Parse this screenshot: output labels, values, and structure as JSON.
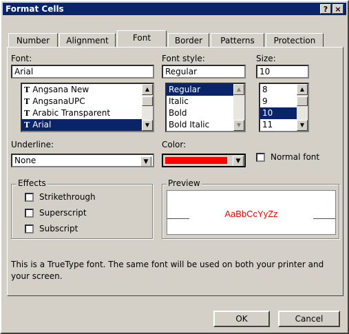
{
  "window": {
    "title": "Format Cells",
    "help_label": "?",
    "close_label": "×"
  },
  "tabs": [
    "Number",
    "Alignment",
    "Font",
    "Border",
    "Patterns",
    "Protection"
  ],
  "font": {
    "label": "Font:",
    "value": "Arial",
    "items": [
      "Angsana New",
      "AngsanaUPC",
      "Arabic Transparent",
      "Arial"
    ],
    "icon_glyph": "T"
  },
  "font_style": {
    "label": "Font style:",
    "value": "Regular",
    "items": [
      "Regular",
      "Italic",
      "Bold",
      "Bold Italic"
    ]
  },
  "size": {
    "label": "Size:",
    "value": "10",
    "items": [
      "8",
      "9",
      "10",
      "11"
    ]
  },
  "underline": {
    "label": "Underline:",
    "value": "None"
  },
  "color": {
    "label": "Color:",
    "swatch": "#ff0000"
  },
  "normal_font": {
    "label": "Normal font"
  },
  "effects": {
    "title": "Effects",
    "items": [
      "Strikethrough",
      "Superscript",
      "Subscript"
    ]
  },
  "preview": {
    "title": "Preview",
    "sample": "AaBbCcYyZz",
    "color": "#ff0000"
  },
  "description": "This is a TrueType font.  The same font will be used on both your printer and your screen.",
  "buttons": {
    "ok": "OK",
    "cancel": "Cancel"
  },
  "glyphs": {
    "up": "▲",
    "down": "▼"
  },
  "accent_color": "#0a246a"
}
